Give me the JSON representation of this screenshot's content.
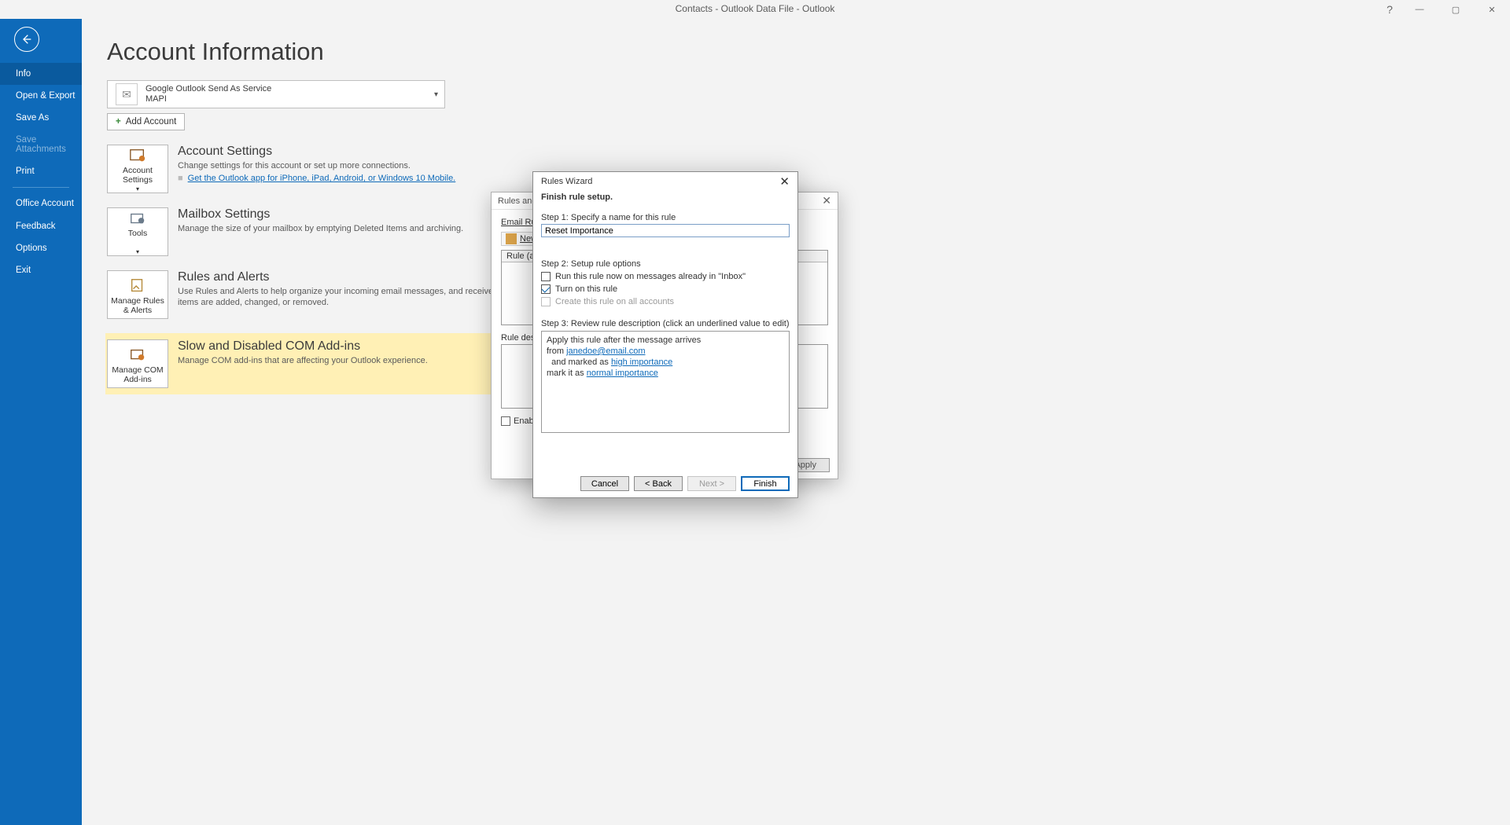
{
  "window": {
    "title": "Contacts - Outlook Data File  -  Outlook",
    "help": "?",
    "minimize": "—",
    "maximize": "▢",
    "close": "✕"
  },
  "sidebar": {
    "items": [
      {
        "label": "Info",
        "selected": true
      },
      {
        "label": "Open & Export"
      },
      {
        "label": "Save As"
      },
      {
        "label": "Save Attachments",
        "disabled": true
      },
      {
        "label": "Print"
      }
    ],
    "lower": [
      {
        "label": "Office Account"
      },
      {
        "label": "Feedback"
      },
      {
        "label": "Options"
      },
      {
        "label": "Exit"
      }
    ]
  },
  "page": {
    "title": "Account Information",
    "account": {
      "name": "Google Outlook Send As Service",
      "protocol": "MAPI"
    },
    "add_account": "Add Account",
    "sections": {
      "settings": {
        "button": "Account Settings",
        "heading": "Account Settings",
        "desc": "Change settings for this account or set up more connections.",
        "link": "Get the Outlook app for iPhone, iPad, Android, or Windows 10 Mobile."
      },
      "mailbox": {
        "button": "Tools",
        "heading": "Mailbox Settings",
        "desc": "Manage the size of your mailbox by emptying Deleted Items and archiving."
      },
      "rules": {
        "button": "Manage Rules & Alerts",
        "heading": "Rules and Alerts",
        "desc": "Use Rules and Alerts to help organize your incoming email messages, and receive updates when items are added, changed, or removed."
      },
      "addins": {
        "button": "Manage COM Add-ins",
        "heading": "Slow and Disabled COM Add-ins",
        "desc": "Manage COM add-ins that are affecting your Outlook experience."
      }
    }
  },
  "back_dialog": {
    "title": "Rules and Alerts",
    "tab": "Email Rules",
    "new_rule": "New Rule...",
    "rule_col": "Rule (applied in order shown)",
    "desc_label": "Rule description (click an underlined value to edit):",
    "enable": "Enable rules on all messages downloaded from RSS Feeds",
    "apply": "Apply"
  },
  "wizard": {
    "title": "Rules Wizard",
    "subtitle": "Finish rule setup.",
    "step1_label": "Step 1: Specify a name for this rule",
    "rule_name": "Reset Importance",
    "step2_label": "Step 2: Setup rule options",
    "opt_run_now": "Run this rule now on messages already in \"Inbox\"",
    "opt_turn_on": "Turn on this rule",
    "opt_all_accounts": "Create this rule on all accounts",
    "step3_label": "Step 3: Review rule description (click an underlined value to edit)",
    "review": {
      "line1": "Apply this rule after the message arrives",
      "line2a": "from ",
      "line2b": "janedoe@email.com",
      "line3a": "  and marked as ",
      "line3b": "high importance",
      "line4a": "mark it as ",
      "line4b": "normal importance"
    },
    "buttons": {
      "cancel": "Cancel",
      "back": "<  Back",
      "next": "Next  >",
      "finish": "Finish"
    }
  }
}
